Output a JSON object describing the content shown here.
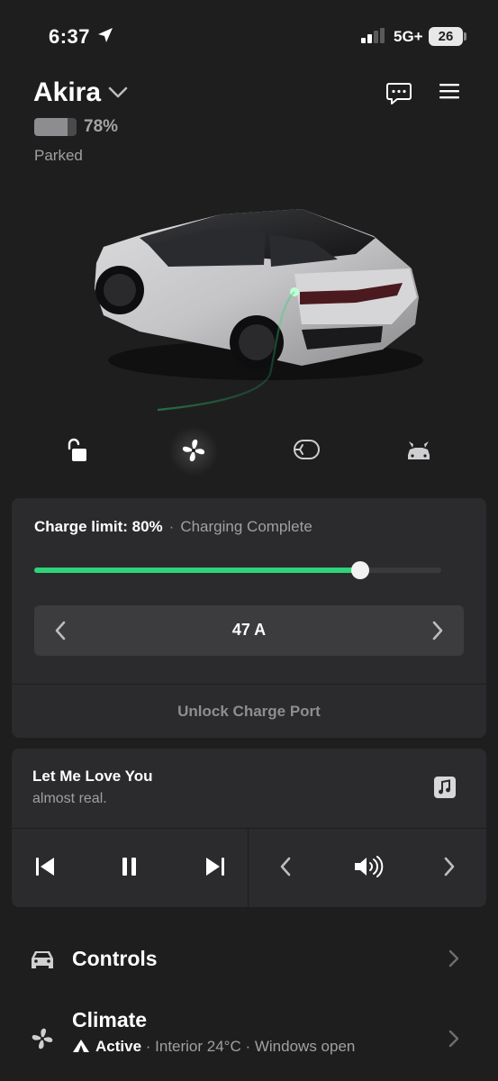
{
  "status_bar": {
    "time": "6:37",
    "network": "5G+",
    "battery": "26"
  },
  "vehicle": {
    "name": "Akira",
    "battery_percent": "78%",
    "battery_level": 0.78,
    "state": "Parked"
  },
  "quick_controls": [
    "lock",
    "fan",
    "charge-port",
    "falcon-doors"
  ],
  "charging": {
    "limit_label": "Charge limit: 80%",
    "separator": "·",
    "status": "Charging Complete",
    "limit_fraction": 0.8,
    "amps": "47 A",
    "unlock_label": "Unlock Charge Port"
  },
  "media": {
    "title": "Let Me Love You",
    "artist": "almost real."
  },
  "rows": {
    "controls": {
      "title": "Controls"
    },
    "climate": {
      "title": "Climate",
      "active": "Active",
      "detail": " · Interior 24°C · Windows open"
    }
  },
  "colors": {
    "background": "#1e1e1f",
    "card": "#2b2b2d",
    "accent": "#2fd37a"
  }
}
